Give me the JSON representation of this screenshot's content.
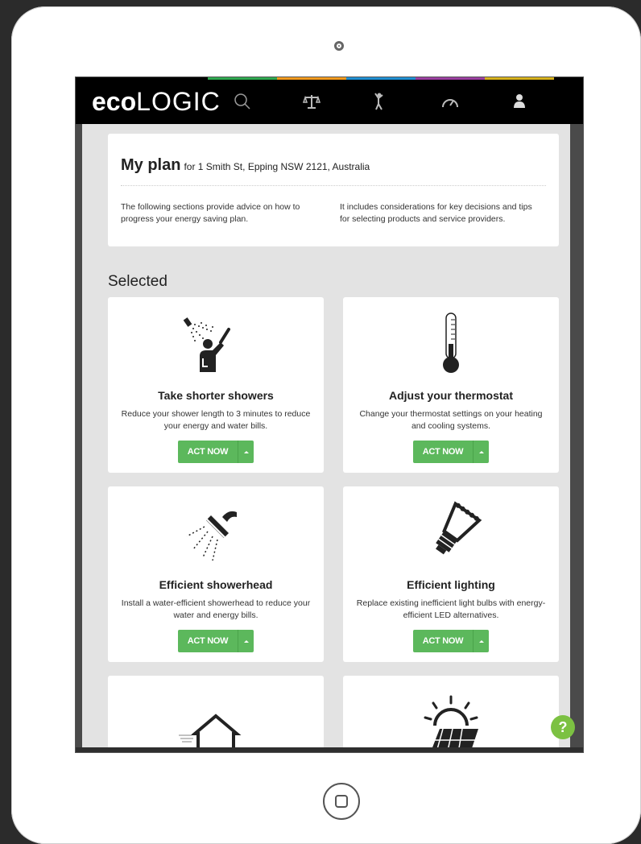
{
  "app": {
    "logo_bold": "eco",
    "logo_thin": "LOGIC"
  },
  "nav": {
    "items": [
      {
        "name": "search-icon"
      },
      {
        "name": "scales-icon"
      },
      {
        "name": "person-icon"
      },
      {
        "name": "gauge-icon"
      },
      {
        "name": "user-icon"
      }
    ],
    "strip_colors": [
      "#2fa84f",
      "#f39a1e",
      "#1f8fd2",
      "#9b3fa0",
      "#d6b11c"
    ]
  },
  "plan": {
    "title": "My plan",
    "address": "for 1 Smith St, Epping NSW 2121, Australia",
    "desc_left": "The following sections provide advice on how to progress your energy saving plan.",
    "desc_right": "It includes considerations for key decisions and tips for selecting products and service providers."
  },
  "section": {
    "title": "Selected"
  },
  "cards": [
    {
      "title": "Take shorter showers",
      "desc": "Reduce your shower length to 3 minutes to reduce your energy and water bills.",
      "button": "ACT NOW",
      "icon": "shower-person-icon"
    },
    {
      "title": "Adjust your thermostat",
      "desc": "Change your thermostat settings on your heating and cooling systems.",
      "button": "ACT NOW",
      "icon": "thermometer-icon"
    },
    {
      "title": "Efficient showerhead",
      "desc": "Install a water-efficient showerhead to reduce your water and energy bills.",
      "button": "ACT NOW",
      "icon": "showerhead-icon"
    },
    {
      "title": "Efficient lighting",
      "desc": "Replace existing inefficient light bulbs with energy-efficient LED alternatives.",
      "button": "ACT NOW",
      "icon": "led-bulb-icon"
    }
  ],
  "help": {
    "label": "?"
  },
  "colors": {
    "accent_green": "#5cb85c",
    "help_green": "#7cc142",
    "navbar": "#000000"
  }
}
